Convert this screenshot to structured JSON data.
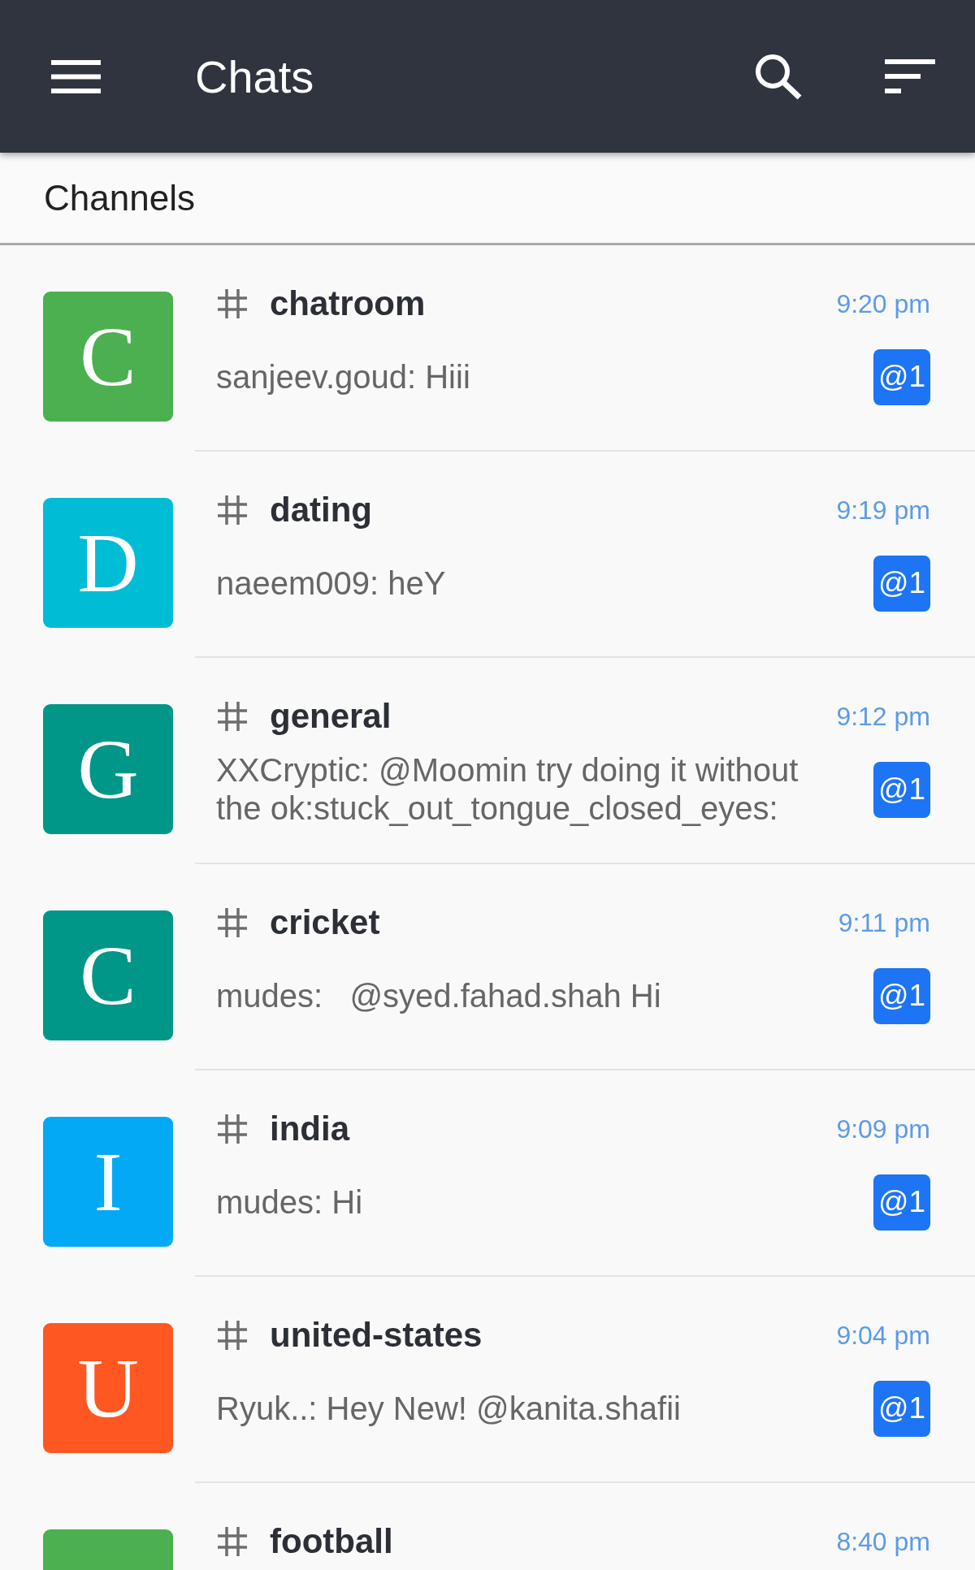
{
  "app_bar": {
    "title": "Chats"
  },
  "section": {
    "label": "Channels"
  },
  "channels": [
    {
      "letter": "C",
      "color": "#4caf50",
      "name": "chatroom",
      "time": "9:20 pm",
      "message": "sanjeev.goud: Hiii",
      "badge": "@1"
    },
    {
      "letter": "D",
      "color": "#00bcd4",
      "name": "dating",
      "time": "9:19 pm",
      "message": "naeem009: heY",
      "badge": "@1"
    },
    {
      "letter": "G",
      "color": "#009688",
      "name": "general",
      "time": "9:12 pm",
      "message": "XXCryptic: @Moomin try doing it without the ok:stuck_out_tongue_closed_eyes:",
      "badge": "@1"
    },
    {
      "letter": "C",
      "color": "#009688",
      "name": "cricket",
      "time": "9:11 pm",
      "message": "mudes:   @syed.fahad.shah Hi",
      "badge": "@1"
    },
    {
      "letter": "I",
      "color": "#03a9f4",
      "name": "india",
      "time": "9:09 pm",
      "message": "mudes: Hi",
      "badge": "@1"
    },
    {
      "letter": "U",
      "color": "#ff5722",
      "name": "united-states",
      "time": "9:04 pm",
      "message": "Ryuk..: Hey New! @kanita.shafii",
      "badge": "@1"
    },
    {
      "color": "#4caf50",
      "name": "football",
      "time": "8:40 pm"
    }
  ]
}
